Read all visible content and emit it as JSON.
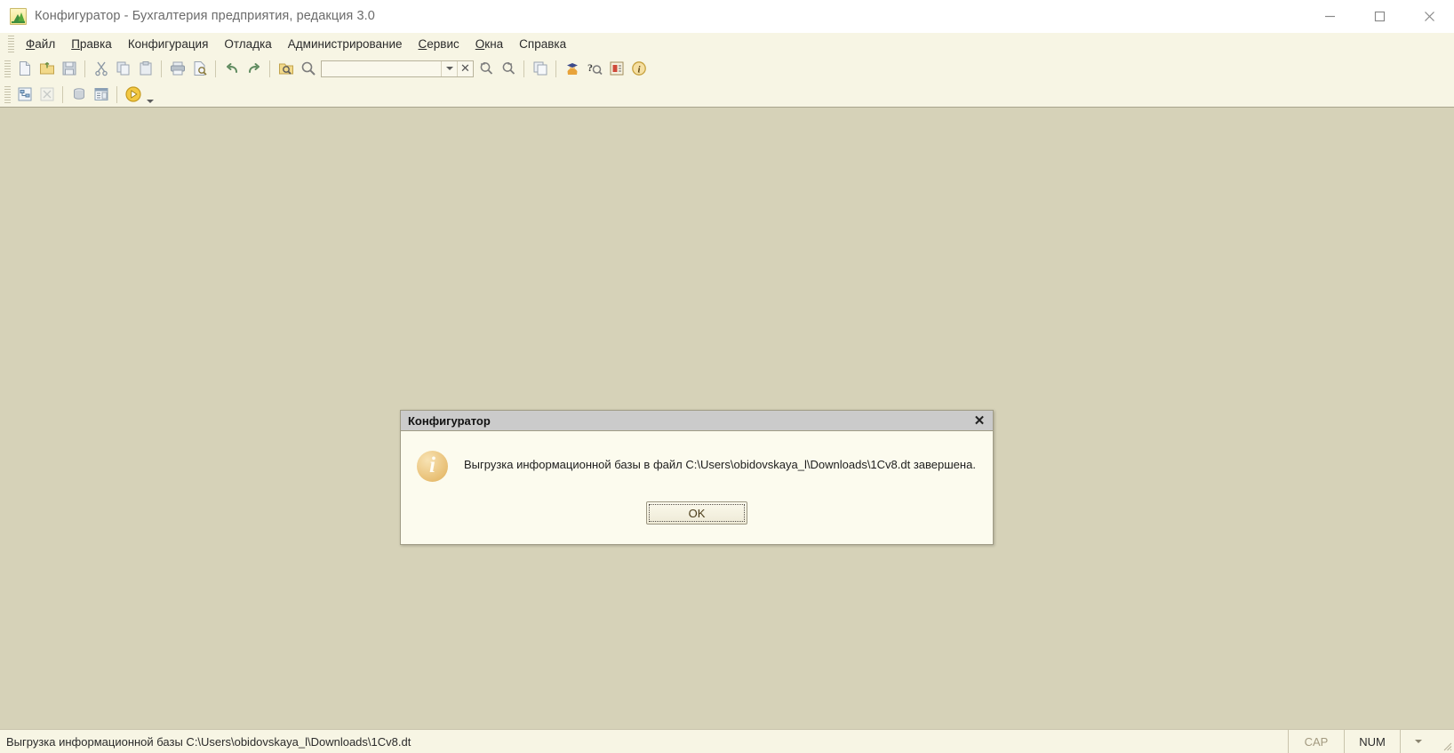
{
  "window": {
    "title": "Конфигуратор - Бухгалтерия предприятия, редакция 3.0",
    "app_icon": "1c-configurator-icon",
    "controls": {
      "minimize": "minimize-icon",
      "maximize": "maximize-icon",
      "close": "close-icon"
    }
  },
  "menubar": {
    "items": [
      {
        "label": "Файл",
        "accel": "Ф"
      },
      {
        "label": "Правка",
        "accel": "П"
      },
      {
        "label": "Конфигурация",
        "accel": "К"
      },
      {
        "label": "Отладка",
        "accel": "О"
      },
      {
        "label": "Администрирование",
        "accel": "А"
      },
      {
        "label": "Сервис",
        "accel": "С"
      },
      {
        "label": "Окна",
        "accel": "О"
      },
      {
        "label": "Справка",
        "accel": "С"
      }
    ]
  },
  "toolbar_main": {
    "buttons": [
      {
        "name": "new-file-icon",
        "title": "Новый"
      },
      {
        "name": "open-folder-icon",
        "title": "Открыть"
      },
      {
        "name": "save-icon",
        "title": "Сохранить"
      },
      {
        "name": "cut-icon",
        "title": "Вырезать"
      },
      {
        "name": "copy-icon",
        "title": "Копировать"
      },
      {
        "name": "paste-icon",
        "title": "Вставить"
      },
      {
        "name": "print-icon",
        "title": "Печать"
      },
      {
        "name": "print-preview-icon",
        "title": "Предварительный просмотр"
      },
      {
        "name": "undo-icon",
        "title": "Отменить"
      },
      {
        "name": "redo-icon",
        "title": "Вернуть"
      },
      {
        "name": "find-in-files-icon",
        "title": "Поиск в файлах"
      },
      {
        "name": "search-icon",
        "title": "Поиск"
      }
    ],
    "search_combo": {
      "value": "",
      "placeholder": "",
      "dropdown_icon": "chevron-down-icon",
      "clear_icon": "clear-x-icon"
    },
    "after_combo": [
      {
        "name": "find-previous-icon",
        "title": "Найти предыдущий"
      },
      {
        "name": "find-next-icon",
        "title": "Найти следующий"
      },
      {
        "name": "windows-cascade-icon",
        "title": "Окна"
      },
      {
        "name": "graduate-icon",
        "title": "Обучение"
      },
      {
        "name": "help-search-icon",
        "title": "Поиск в справке"
      },
      {
        "name": "syntax-helper-icon",
        "title": "Синтакс-помощник"
      },
      {
        "name": "about-info-icon",
        "title": "О программе"
      }
    ]
  },
  "toolbar_second": {
    "buttons": [
      {
        "name": "config-tree-icon",
        "title": "Дерево конфигурации"
      },
      {
        "name": "config-compare-icon",
        "title": "Сравнить конфигурации"
      },
      {
        "name": "database-icon",
        "title": "База данных"
      },
      {
        "name": "window-list-icon",
        "title": "Окна"
      },
      {
        "name": "start-debug-icon",
        "title": "Начать отладку"
      }
    ],
    "dropdown_icon": "chevron-down-icon"
  },
  "dialog": {
    "title": "Конфигуратор",
    "close_icon": "close-icon",
    "icon": "info-icon",
    "icon_glyph": "i",
    "message": "Выгрузка информационной базы в файл C:\\Users\\obidovskaya_l\\Downloads\\1Cv8.dt завершена.",
    "ok_label": "OK"
  },
  "statusbar": {
    "message": "Выгрузка информационной базы C:\\Users\\obidovskaya_l\\Downloads\\1Cv8.dt",
    "cells": [
      {
        "label": "CAP",
        "state": "dim"
      },
      {
        "label": "NUM",
        "state": "strong"
      }
    ],
    "dropdown_icon": "chevron-down-icon",
    "resize_grip": "resize-grip-icon"
  },
  "colors": {
    "app_background": "#f7f5e4",
    "workspace": "#d6d2b8",
    "dialog_background": "#fcfbee",
    "dialog_titlebar": "#cbcbcb",
    "title_text": "#6b6b6b",
    "info_icon": "#e8bf74"
  }
}
